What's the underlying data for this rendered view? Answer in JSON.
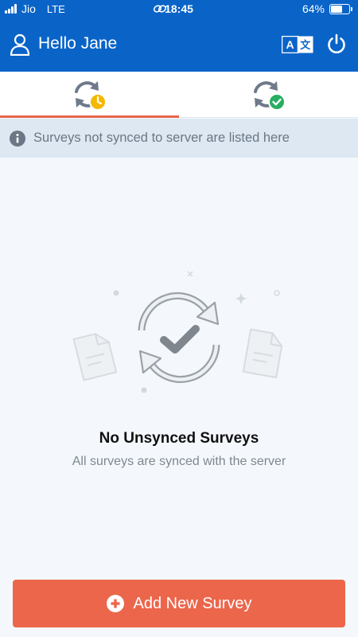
{
  "status_bar": {
    "carrier": "Jio",
    "network": "LTE",
    "time": "18:45",
    "battery_percent": "64%",
    "battery_level": 0.64
  },
  "header": {
    "greeting": "Hello Jane",
    "icons": [
      "user-icon",
      "translate-icon",
      "power-icon"
    ]
  },
  "tabs": [
    {
      "name": "unsynced",
      "icon": "sync-pending-icon",
      "active": true
    },
    {
      "name": "synced",
      "icon": "sync-done-icon",
      "active": false
    }
  ],
  "info_banner": {
    "text": "Surveys not synced to server are listed here"
  },
  "empty_state": {
    "title": "No Unsynced Surveys",
    "subtitle": "All surveys are synced with the server"
  },
  "add_button": {
    "label": "Add New Survey"
  },
  "colors": {
    "header_blue": "#0a64c8",
    "accent_orange": "#ec664b",
    "pending_yellow": "#f5b800",
    "done_green": "#27ae60",
    "banner_bg": "#dde8f2"
  }
}
